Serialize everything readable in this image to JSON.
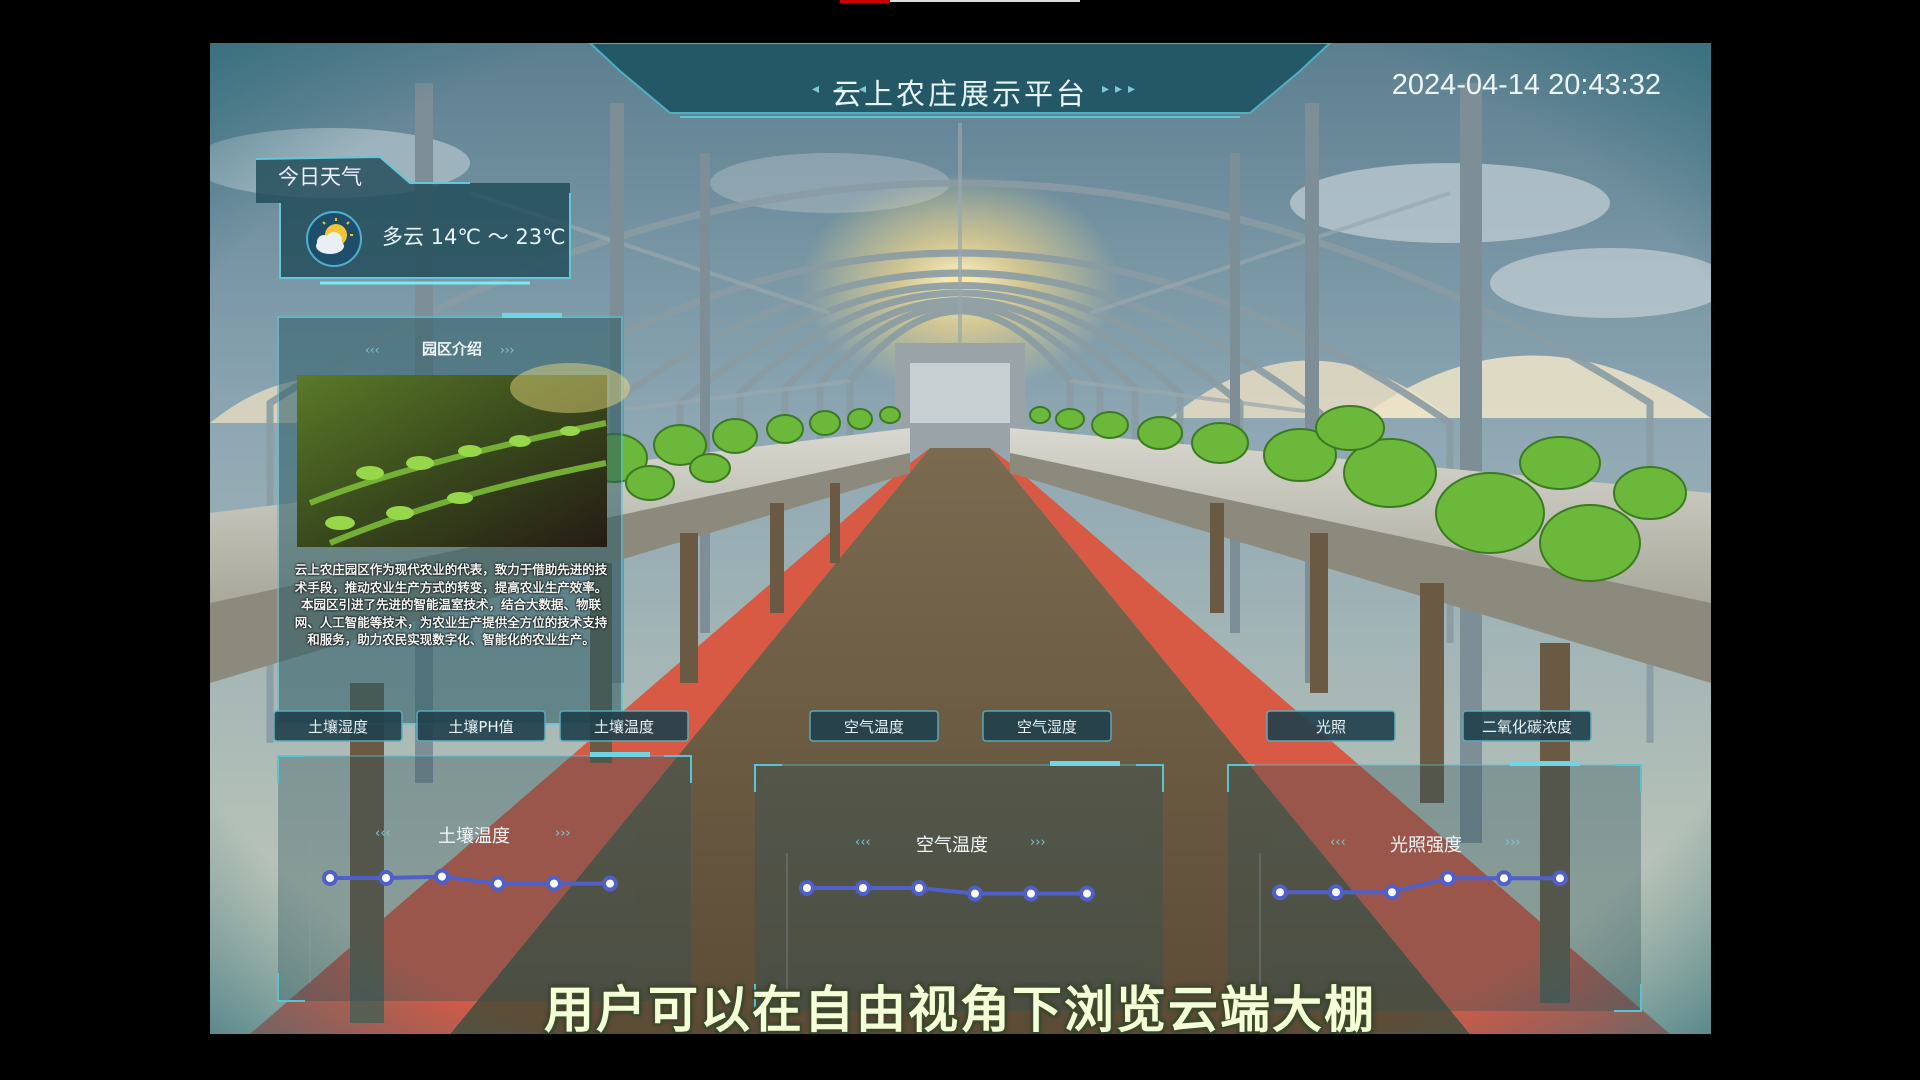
{
  "header": {
    "title": "云上农庄展示平台",
    "left_arrows": "◂ ◂ ◂",
    "right_arrows": "▸▸▸",
    "datetime": "2024-04-14 20:43:32"
  },
  "weather": {
    "panel_title": "今日天气",
    "icon": "partly-cloudy-icon",
    "summary": "多云  14℃ ～ 23℃"
  },
  "intro": {
    "panel_title": "园区介绍",
    "photo": "seedling-field-photo",
    "text": "云上农庄园区作为现代农业的代表，致力于借助先进的技术手段，推动农业生产方式的转变，提高农业生产效率。本园区引进了先进的智能温室技术，结合大数据、物联网、人工智能等技术，为农业生产提供全方位的技术支持和服务，助力农民实现数字化、智能化的农业生产。"
  },
  "tabs": {
    "soil_humidity": "土壤湿度",
    "soil_ph": "土壤PH值",
    "soil_temperature": "土壤温度",
    "air_temperature": "空气温度",
    "air_humidity": "空气湿度",
    "light": "光照",
    "co2": "二氧化碳浓度"
  },
  "chart_data": [
    {
      "type": "line",
      "title": "土壤温度",
      "values": [
        0.75,
        0.75,
        0.76,
        0.71,
        0.71,
        0.71
      ]
    },
    {
      "type": "line",
      "title": "空气温度",
      "values": [
        0.75,
        0.75,
        0.75,
        0.71,
        0.71,
        0.71
      ]
    },
    {
      "type": "line",
      "title": "光照强度",
      "values": [
        0.72,
        0.72,
        0.72,
        0.82,
        0.82,
        0.82
      ]
    }
  ],
  "subtitle": "用户可以在自由视角下浏览云端大棚",
  "colors": {
    "panel_border": "#5fd0e0",
    "line": "#5060c8",
    "soil_red": "#e06048",
    "path": "#6b5a42"
  }
}
